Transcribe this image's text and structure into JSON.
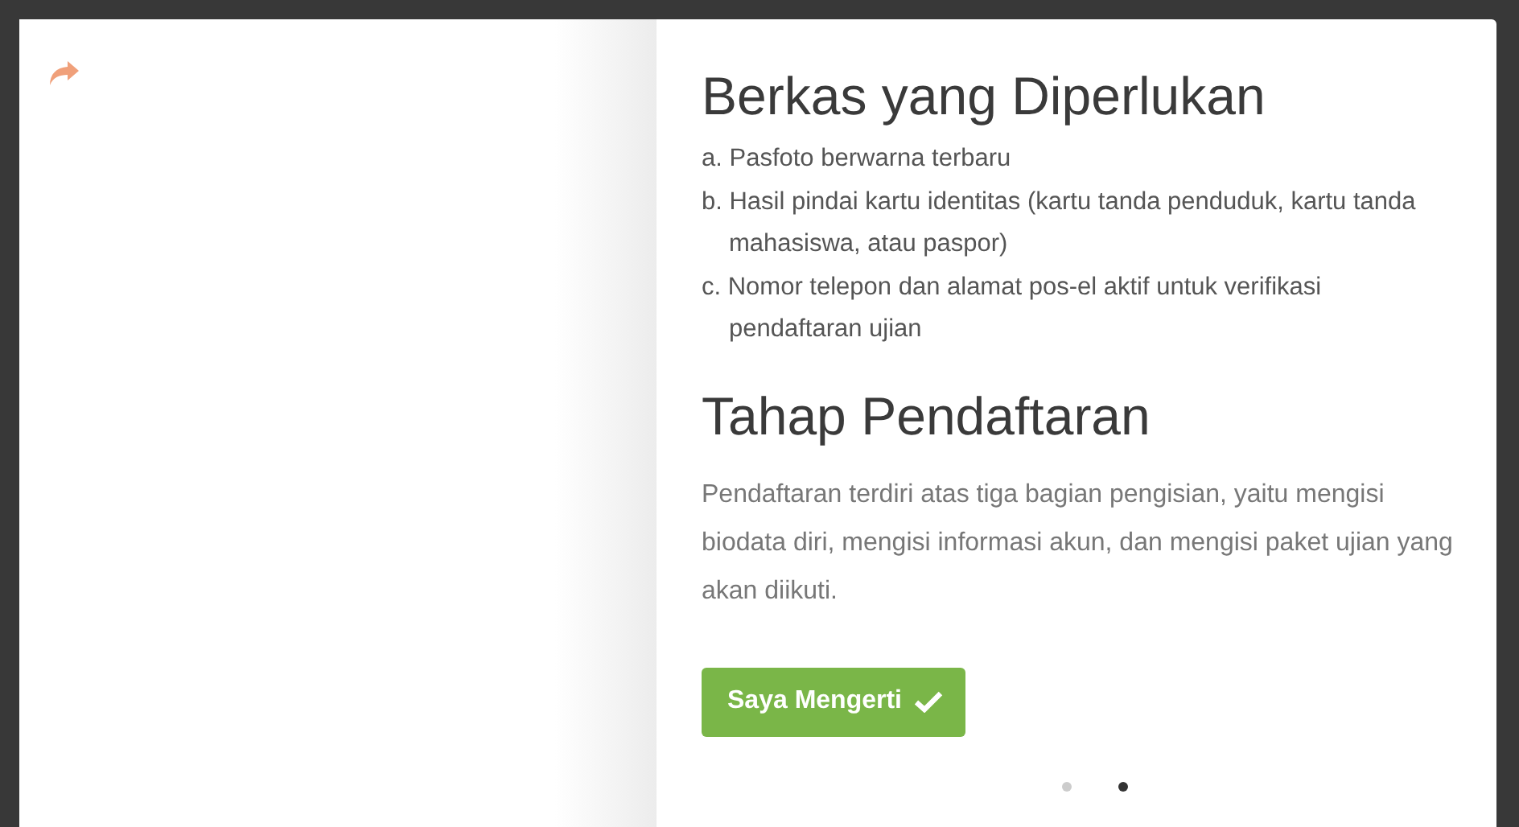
{
  "sections": [
    {
      "kind": "list",
      "title": "Berkas yang Diperlukan",
      "items": [
        "a. Pasfoto berwarna terbaru",
        "b. Hasil pindai kartu identitas (kartu tanda penduduk, kartu tanda mahasiswa, atau paspor)",
        "c. Nomor telepon dan alamat pos-el aktif untuk verifikasi pendaftaran ujian"
      ]
    },
    {
      "kind": "paragraph",
      "title": "Tahap Pendaftaran",
      "text": "Pendaftaran terdiri atas tiga bagian pengisian, yaitu mengisi biodata diri, mengisi informasi akun, dan mengisi paket ujian yang akan diikuti."
    }
  ],
  "button": {
    "label": "Saya Mengerti"
  },
  "pager": [
    {
      "selected": false
    },
    {
      "selected": true
    }
  ]
}
